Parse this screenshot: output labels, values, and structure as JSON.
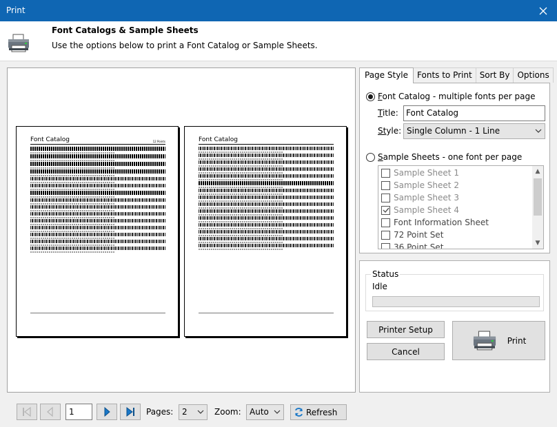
{
  "window": {
    "title": "Print"
  },
  "header": {
    "title": "Font Catalogs & Sample Sheets",
    "description": "Use the options below to print a Font Catalog or Sample Sheets."
  },
  "preview": {
    "page1": {
      "title": "Font Catalog",
      "marker": "12 Points"
    },
    "page2": {
      "title": "Font Catalog"
    }
  },
  "tabs": [
    {
      "label": "Page Style",
      "active": true
    },
    {
      "label": "Fonts to Print"
    },
    {
      "label": "Sort By"
    },
    {
      "label": "Options"
    }
  ],
  "page_style": {
    "font_catalog_option": {
      "prefix": "F",
      "rest": "ont Catalog - multiple fonts per page",
      "selected": true
    },
    "title_label": {
      "prefix": "T",
      "rest": "itle:"
    },
    "title_value": "Font Catalog",
    "style_label": {
      "prefix": "St",
      "rest": "yle:"
    },
    "style_value": "Single Column - 1 Line",
    "sample_sheets_option": {
      "prefix": "S",
      "rest": "ample Sheets - one font per page",
      "selected": false
    },
    "sample_sheets": [
      {
        "label": "Sample Sheet 1",
        "checked": false
      },
      {
        "label": "Sample Sheet 3",
        "checked": false
      },
      {
        "label": "Sample Sheet 2",
        "checked": false
      },
      {
        "label": "Sample Sheet 4",
        "checked": true
      },
      {
        "label": "Font Information Sheet",
        "checked": false
      },
      {
        "label": "72 Point Set",
        "checked": false
      },
      {
        "label": "36 Point Set",
        "checked": false
      }
    ]
  },
  "status": {
    "legend": "Status",
    "text": "Idle",
    "progress": 0
  },
  "buttons": {
    "printer_setup": "Printer Setup",
    "cancel": "Cancel",
    "print": "Print"
  },
  "navigation": {
    "page_number": "1",
    "pages_label": "Pages:",
    "pages_value": "2",
    "zoom_label": "Zoom:",
    "zoom_value": "Auto",
    "refresh": "Refresh"
  }
}
